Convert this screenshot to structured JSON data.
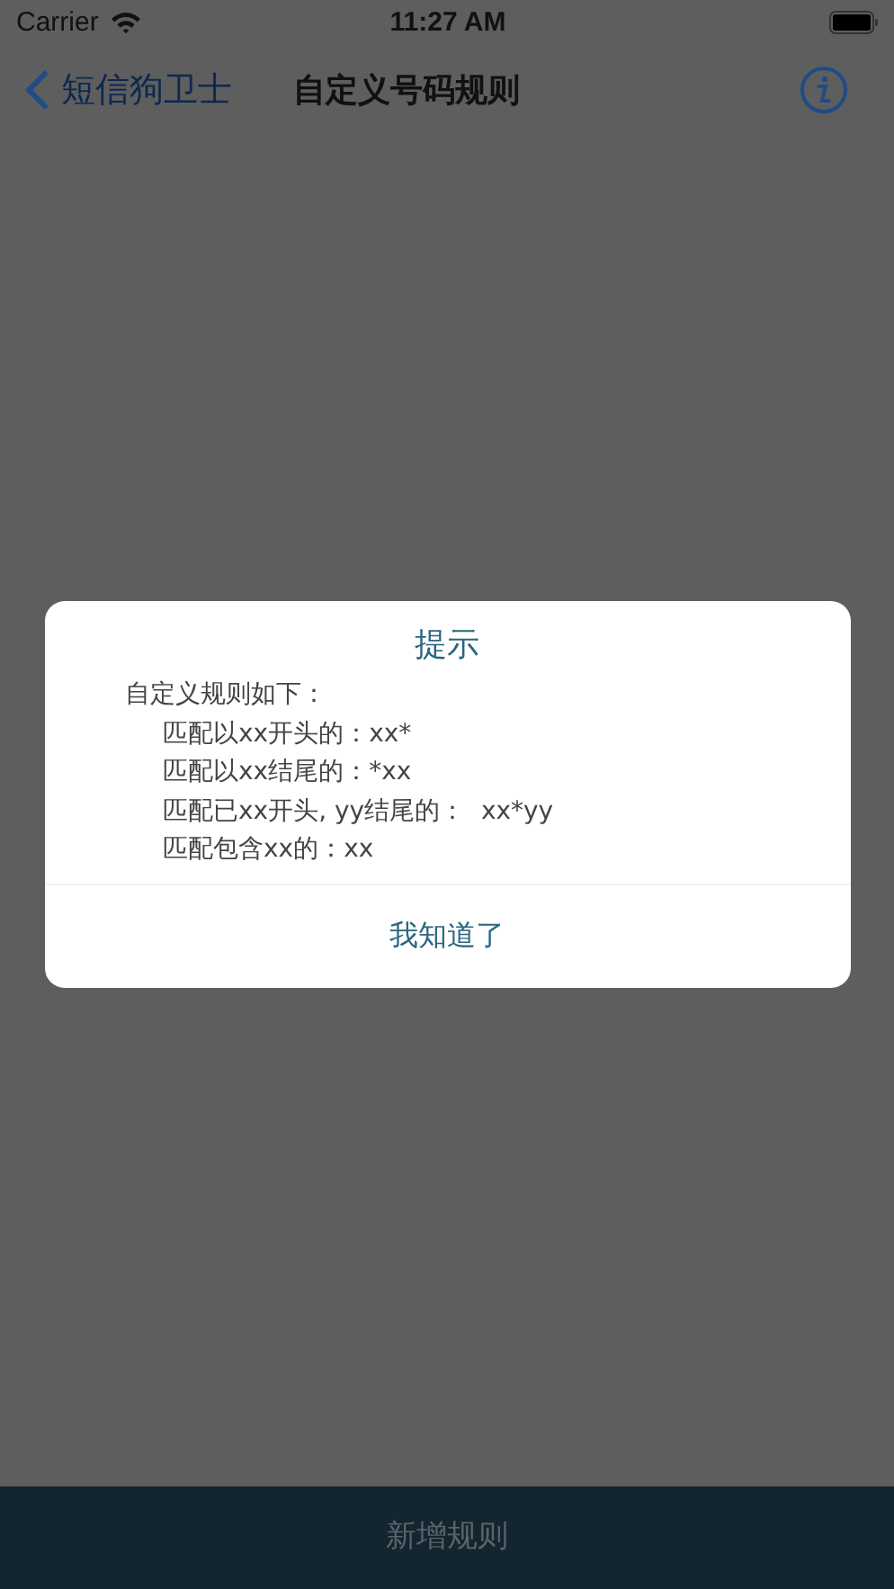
{
  "status_bar": {
    "carrier": "Carrier",
    "time": "11:27 AM"
  },
  "nav": {
    "back_label": "短信狗卫士",
    "title": "自定义号码规则"
  },
  "alert": {
    "title": "提示",
    "lines": [
      {
        "text": "自定义规则如下：",
        "indented": false
      },
      {
        "text": "匹配以xx开头的：xx*",
        "indented": true
      },
      {
        "text": "匹配以xx结尾的：*xx",
        "indented": true
      },
      {
        "text": "匹配已xx开头, yy结尾的：  xx*yy",
        "indented": true
      },
      {
        "text": "匹配包含xx的：xx",
        "indented": true
      }
    ],
    "button": "我知道了"
  },
  "bottom_button": "新增规则"
}
